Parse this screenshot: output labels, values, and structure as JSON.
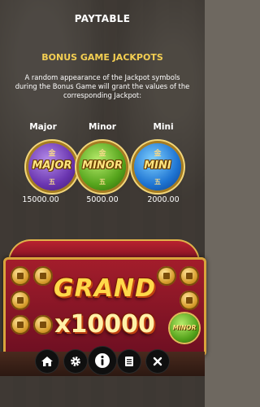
{
  "header": {
    "title": "PAYTABLE"
  },
  "section": {
    "heading": "BONUS GAME JACKPOTS",
    "description": "A random appearance of the Jackpot symbols during the Bonus Game will grant the values of the corresponding Jackpot:"
  },
  "jackpots": [
    {
      "name": "Major",
      "symbol_label": "MAJOR",
      "top_char": "金",
      "bottom_char": "五",
      "value": "15000.00",
      "color": "#6a35b0"
    },
    {
      "name": "Minor",
      "symbol_label": "MINOR",
      "top_char": "金",
      "bottom_char": "五",
      "value": "5000.00",
      "color": "#55a41c"
    },
    {
      "name": "Mini",
      "symbol_label": "MINI",
      "top_char": "金",
      "bottom_char": "五",
      "value": "2000.00",
      "color": "#1e74d2"
    }
  ],
  "grand": {
    "title": "GRAND",
    "multiplier": "x10000",
    "side_symbol": "MINOR"
  },
  "toolbar": {
    "buttons": [
      {
        "icon": "home-icon"
      },
      {
        "icon": "gear-icon"
      },
      {
        "icon": "info-icon"
      },
      {
        "icon": "paytable-icon"
      },
      {
        "icon": "close-icon"
      }
    ]
  }
}
